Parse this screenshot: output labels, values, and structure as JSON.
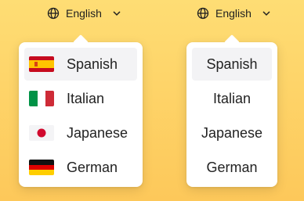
{
  "left": {
    "selector_label": "English",
    "items": [
      {
        "label": "Spanish",
        "flag": "spain-flag-icon"
      },
      {
        "label": "Italian",
        "flag": "italy-flag-icon"
      },
      {
        "label": "Japanese",
        "flag": "japan-flag-icon"
      },
      {
        "label": "German",
        "flag": "germany-flag-icon"
      }
    ]
  },
  "right": {
    "selector_label": "English",
    "items": [
      {
        "label": "Spanish"
      },
      {
        "label": "Italian"
      },
      {
        "label": "Japanese"
      },
      {
        "label": "German"
      }
    ]
  },
  "colors": {
    "background_top": "#fedd74",
    "background_bottom": "#fdc85a",
    "menu_bg": "#ffffff",
    "active_item_bg": "#f3f3f5"
  },
  "icons": [
    "globe-icon",
    "chevron-down-icon"
  ]
}
